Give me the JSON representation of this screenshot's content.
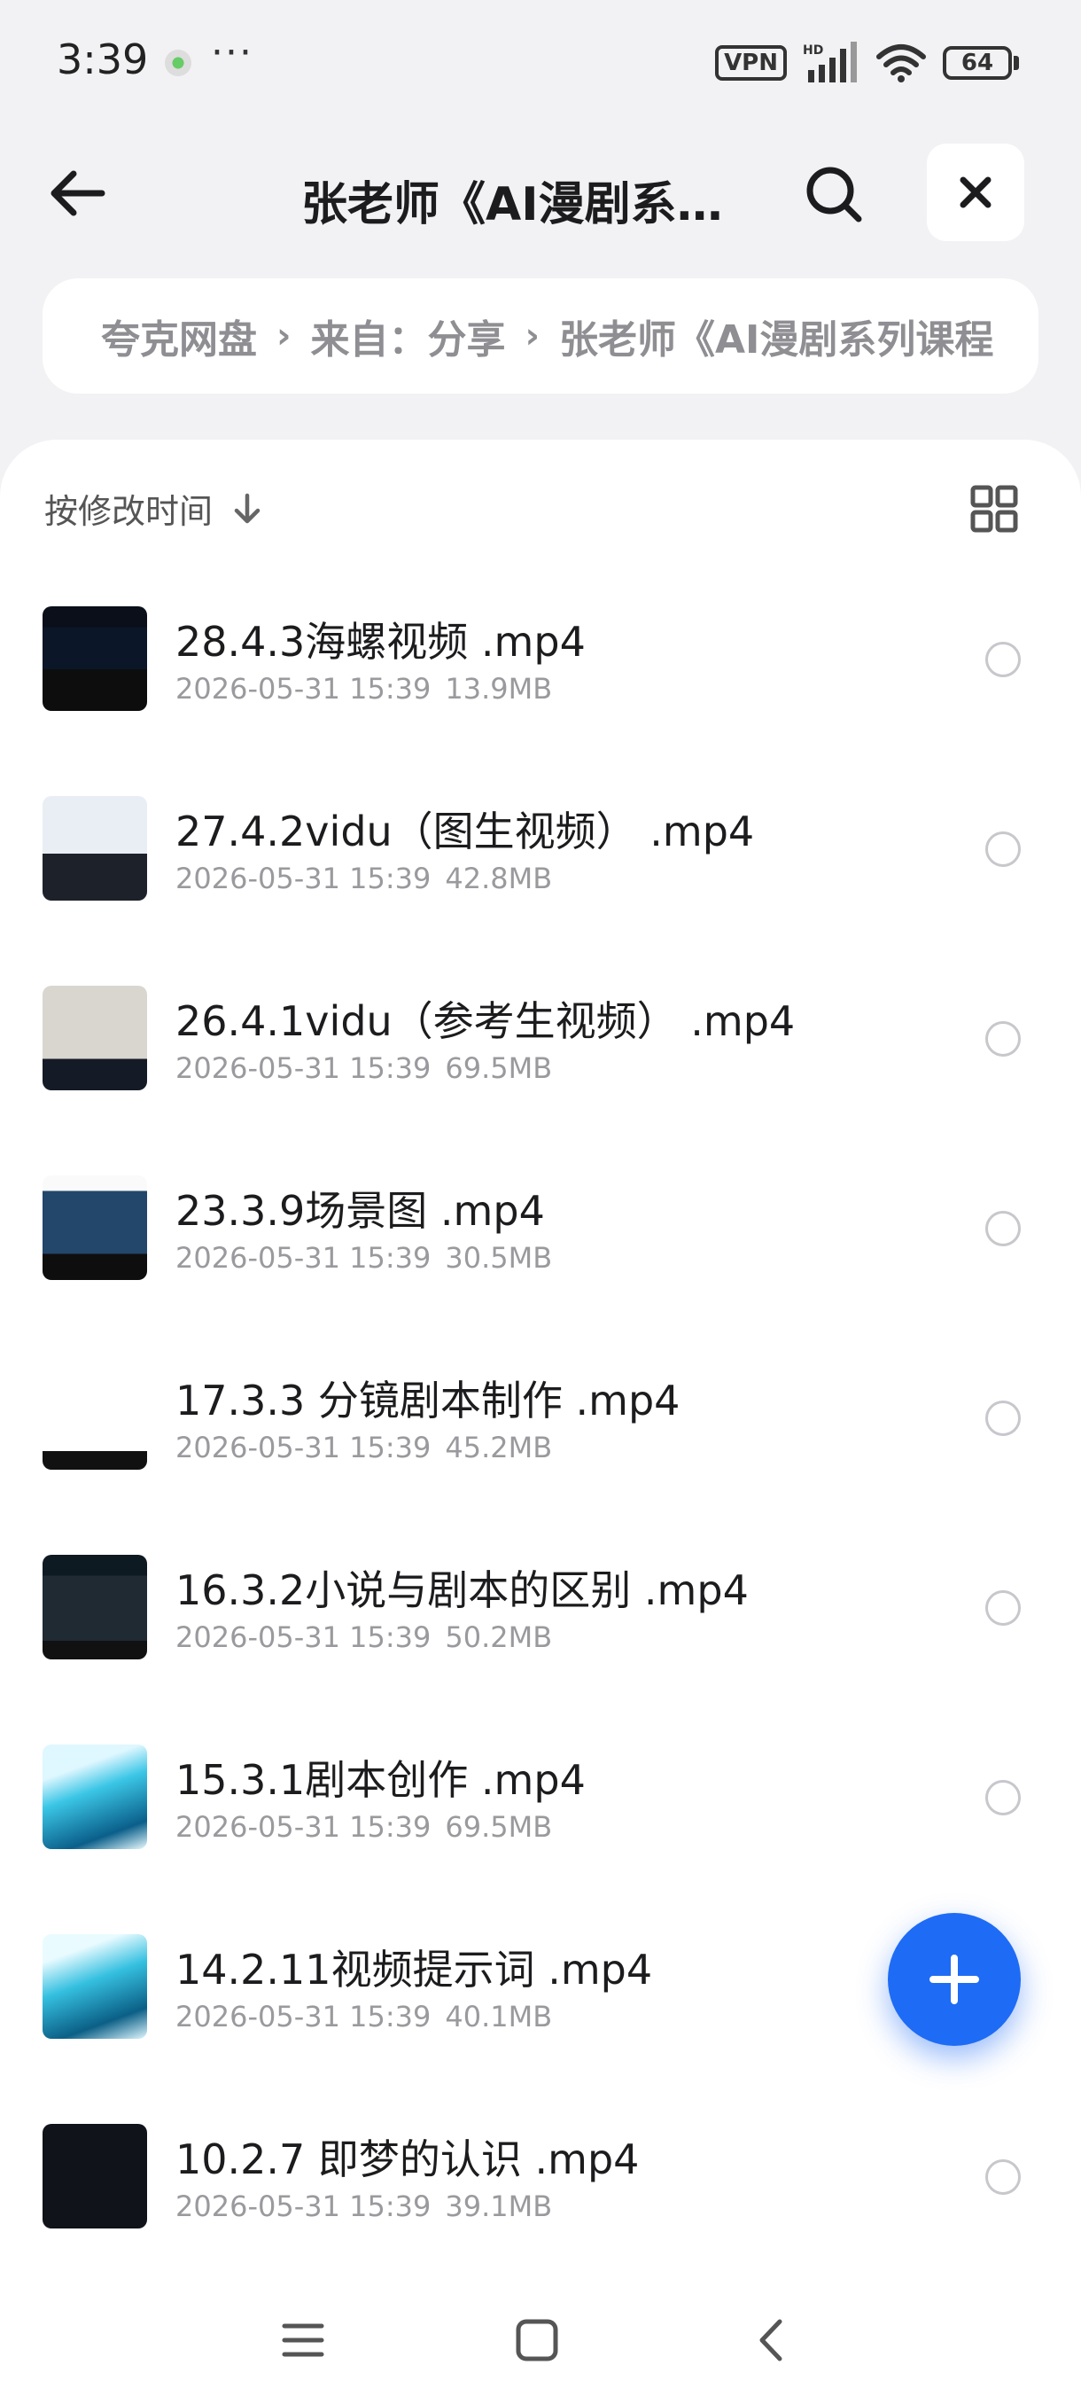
{
  "status": {
    "time": "3:39",
    "dots": "···",
    "vpn": "VPN",
    "network": "HD",
    "battery": "64"
  },
  "header": {
    "title": "张老师《AI漫剧系列…"
  },
  "breadcrumb": {
    "items": [
      "夸克网盘",
      "来自：分享",
      "张老师《AI漫剧系列课程"
    ]
  },
  "list": {
    "sort_label": "按修改时间",
    "files": [
      {
        "name": "28.4.3海螺视频 .mp4",
        "date": "2026-05-31 15:39",
        "size": "13.9MB"
      },
      {
        "name": "27.4.2vidu（图生视频） .mp4",
        "date": "2026-05-31 15:39",
        "size": "42.8MB"
      },
      {
        "name": "26.4.1vidu（参考生视频） .mp4",
        "date": "2026-05-31 15:39",
        "size": "69.5MB"
      },
      {
        "name": "23.3.9场景图 .mp4",
        "date": "2026-05-31 15:39",
        "size": "30.5MB"
      },
      {
        "name": "17.3.3 分镜剧本制作 .mp4",
        "date": "2026-05-31 15:39",
        "size": "45.2MB"
      },
      {
        "name": "16.3.2小说与剧本的区别 .mp4",
        "date": "2026-05-31 15:39",
        "size": "50.2MB"
      },
      {
        "name": "15.3.1剧本创作 .mp4",
        "date": "2026-05-31 15:39",
        "size": "69.5MB"
      },
      {
        "name": "14.2.11视频提示词 .mp4",
        "date": "2026-05-31 15:39",
        "size": "40.1MB"
      },
      {
        "name": "10.2.7 即梦的认识 .mp4",
        "date": "2026-05-31 15:39",
        "size": "39.1MB"
      }
    ]
  },
  "colors": {
    "accent": "#1e6bf5",
    "background": "#f2f2f4",
    "meta_text": "#9a9a9e"
  },
  "icons": {
    "back": "arrow-left-icon",
    "search": "search-icon",
    "close": "close-icon",
    "sort": "arrow-down-icon",
    "grid": "grid-view-icon",
    "fab": "plus-icon",
    "nav_menu": "menu-icon",
    "nav_home": "home-square-icon",
    "nav_back": "chevron-left-icon"
  }
}
